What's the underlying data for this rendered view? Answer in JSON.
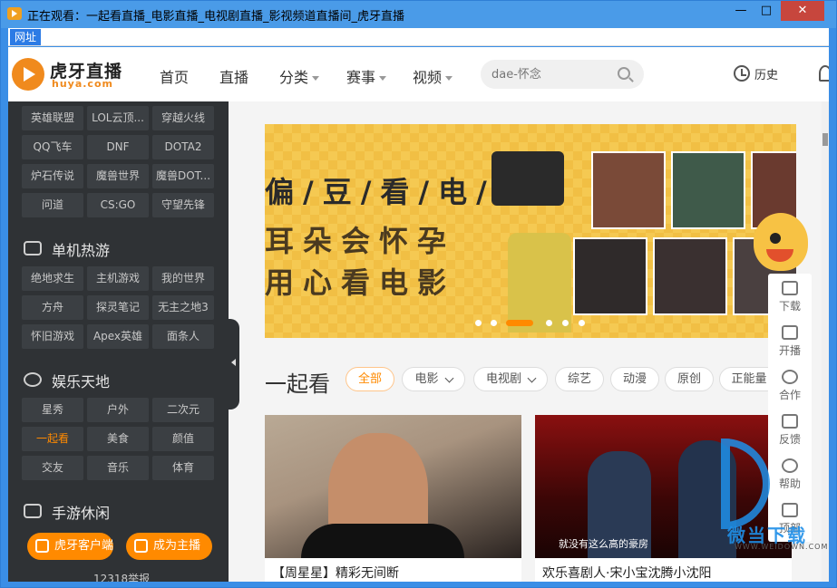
{
  "window": {
    "title": "正在观看：一起看直播_电影直播_电视剧直播_影视频道直播间_虎牙直播",
    "minimize": "—",
    "maximize": "□",
    "close": "✕"
  },
  "addressbar": {
    "label": "网址"
  },
  "header": {
    "logo_cn": "虎牙直播",
    "logo_en": "huya.com",
    "nav": [
      {
        "label": "首页"
      },
      {
        "label": "直播"
      },
      {
        "label": "分类"
      },
      {
        "label": "赛事"
      },
      {
        "label": "视频"
      }
    ],
    "search_placeholder": "dae-怀念",
    "history": "历史"
  },
  "sidebar": {
    "game_chips": [
      "英雄联盟",
      "LOL云顶...",
      "穿越火线",
      "QQ飞车",
      "DNF",
      "DOTA2",
      "炉石传说",
      "魔兽世界",
      "魔兽DOT...",
      "问道",
      "CS:GO",
      "守望先锋"
    ],
    "section_single": "单机热游",
    "single_chips": [
      "绝地求生",
      "主机游戏",
      "我的世界",
      "方舟",
      "探灵笔记",
      "无主之地3",
      "怀旧游戏",
      "Apex英雄",
      "面条人"
    ],
    "section_ent": "娱乐天地",
    "ent_chips": [
      "星秀",
      "户外",
      "二次元",
      "一起看",
      "美食",
      "颜值",
      "交友",
      "音乐",
      "体育"
    ],
    "ent_active": "一起看",
    "section_mobile": "手游休闲",
    "client_button": "虎牙客户端",
    "anchor_button": "成为主播",
    "report": "12318举报"
  },
  "banner": {
    "line1": "偏/豆/看/电/影",
    "line2": "耳朵会怀孕",
    "line3": "用心看电影",
    "slide_count": 7,
    "active_slide": 3
  },
  "main": {
    "section_title": "一起看",
    "filters": [
      "全部",
      "电影",
      "电视剧",
      "综艺",
      "动漫",
      "原创",
      "正能量"
    ],
    "cards": [
      {
        "caption": "【周星星】精彩无间断"
      },
      {
        "caption": "欢乐喜剧人·宋小宝沈腾小沈阳",
        "subtitle": "就没有这么高的豪房"
      }
    ]
  },
  "float_panel": {
    "items": [
      "下载",
      "开播",
      "合作",
      "反馈",
      "帮助",
      "顶部"
    ]
  },
  "watermark": {
    "text": "微当下载",
    "url": "WWW.WEIDOWN.COM"
  }
}
